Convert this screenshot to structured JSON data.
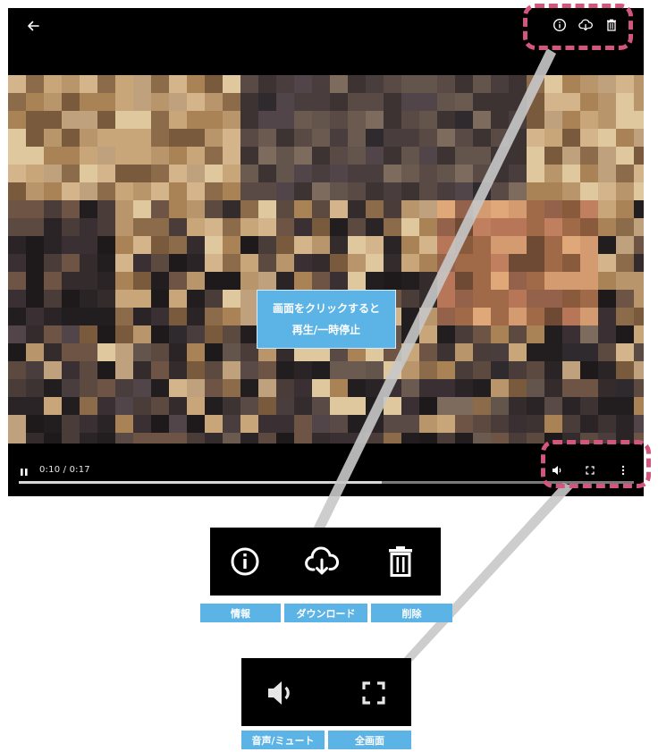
{
  "player": {
    "time_display": "0:10 / 0:17",
    "progress": 0.59,
    "center_hint": {
      "line1": "画面をクリックすると",
      "line2": "再生/一時停止"
    }
  },
  "icons": {
    "top": [
      "back-arrow-icon",
      "info-icon",
      "cloud-download-icon",
      "trash-icon"
    ],
    "bottom": [
      "pause-icon",
      "volume-icon",
      "fullscreen-icon",
      "more-vertical-icon"
    ]
  },
  "callouts": {
    "top_labels": {
      "info": "情報",
      "download": "ダウンロード",
      "delete": "削除"
    },
    "bottom_labels": {
      "mute": "音声/ミュート",
      "fullscreen": "全画面"
    }
  },
  "colors": {
    "accent_blue": "#5bb3e6",
    "highlight_pink": "#d3567c",
    "connector_gray": "#c8c8c8",
    "player_bg": "#000000"
  }
}
